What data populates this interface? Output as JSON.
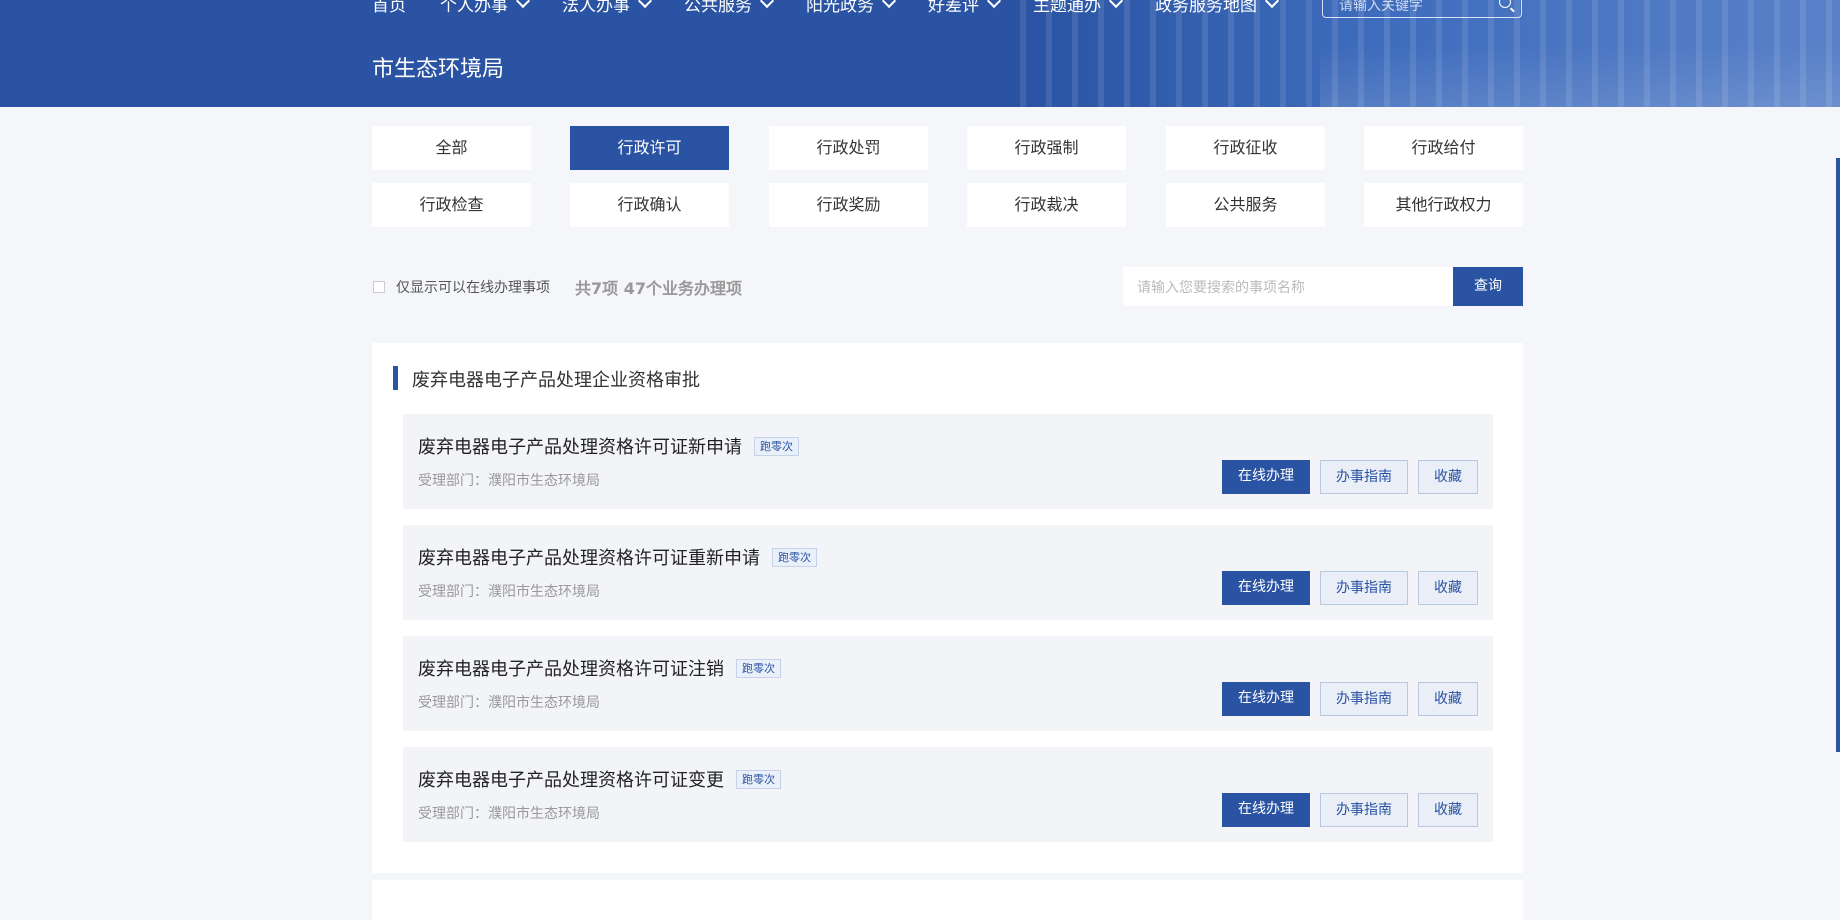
{
  "header": {
    "nav": [
      {
        "label": "首页",
        "has_dropdown": false
      },
      {
        "label": "个人办事",
        "has_dropdown": true
      },
      {
        "label": "法人办事",
        "has_dropdown": true
      },
      {
        "label": "公共服务",
        "has_dropdown": true
      },
      {
        "label": "阳光政务",
        "has_dropdown": true
      },
      {
        "label": "好差评",
        "has_dropdown": true
      },
      {
        "label": "主题通办",
        "has_dropdown": true
      },
      {
        "label": "政务服务地图",
        "has_dropdown": true
      }
    ],
    "search_placeholder": "请输入关键字",
    "dept_title": "市生态环境局"
  },
  "categories": [
    {
      "label": "全部",
      "active": false
    },
    {
      "label": "行政许可",
      "active": true
    },
    {
      "label": "行政处罚",
      "active": false
    },
    {
      "label": "行政强制",
      "active": false
    },
    {
      "label": "行政征收",
      "active": false
    },
    {
      "label": "行政给付",
      "active": false
    },
    {
      "label": "行政检查",
      "active": false
    },
    {
      "label": "行政确认",
      "active": false
    },
    {
      "label": "行政奖励",
      "active": false
    },
    {
      "label": "行政裁决",
      "active": false
    },
    {
      "label": "公共服务",
      "active": false
    },
    {
      "label": "其他行政权力",
      "active": false
    }
  ],
  "filter": {
    "online_only_label": "仅显示可以在线办理事项",
    "online_only_checked": false,
    "count_text": "共7项 47个业务办理项",
    "search_placeholder": "请输入您要搜索的事项名称",
    "search_button": "查询"
  },
  "section": {
    "title": "废弃电器电子产品处理企业资格审批",
    "items": [
      {
        "name": "废弃电器电子产品处理资格许可证新申请",
        "tag": "跑零次",
        "dept": "受理部门：濮阳市生态环境局",
        "btn_online": "在线办理",
        "btn_guide": "办事指南",
        "btn_fav": "收藏"
      },
      {
        "name": "废弃电器电子产品处理资格许可证重新申请",
        "tag": "跑零次",
        "dept": "受理部门：濮阳市生态环境局",
        "btn_online": "在线办理",
        "btn_guide": "办事指南",
        "btn_fav": "收藏"
      },
      {
        "name": "废弃电器电子产品处理资格许可证注销",
        "tag": "跑零次",
        "dept": "受理部门：濮阳市生态环境局",
        "btn_online": "在线办理",
        "btn_guide": "办事指南",
        "btn_fav": "收藏"
      },
      {
        "name": "废弃电器电子产品处理资格许可证变更",
        "tag": "跑零次",
        "dept": "受理部门：濮阳市生态环境局",
        "btn_online": "在线办理",
        "btn_guide": "办事指南",
        "btn_fav": "收藏"
      }
    ]
  },
  "colors": {
    "primary": "#2a53a3",
    "page_bg": "#f4f6f9",
    "item_bg": "#f2f4f8"
  }
}
